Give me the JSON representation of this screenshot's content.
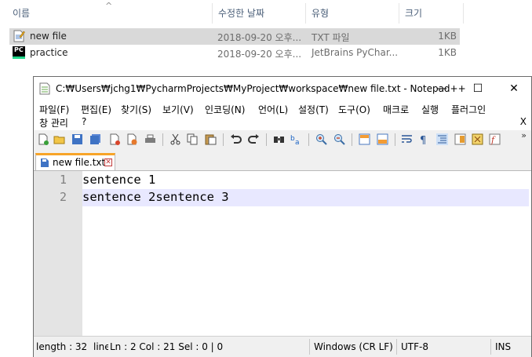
{
  "explorer": {
    "columns": {
      "name": "이름",
      "date": "수정한 날짜",
      "type": "유형",
      "size": "크기"
    },
    "files": [
      {
        "name": "new file",
        "date": "2018-09-20 오후...",
        "type": "TXT 파일",
        "size": "1KB",
        "icon": "text-file-icon",
        "selected": true
      },
      {
        "name": "practice",
        "date": "2018-09-20 오후...",
        "type": "JetBrains PyChar...",
        "size": "1KB",
        "icon": "pycharm-icon",
        "selected": false
      }
    ]
  },
  "window": {
    "title": "C:₩Users₩jchg1₩PycharmProjects₩MyProject₩workspace₩new file.txt - Notepad++",
    "controls": {
      "minimize": "—",
      "maximize": "☐",
      "close": "✕"
    }
  },
  "menu": {
    "items": [
      "파일(F)",
      "편집(E)",
      "찾기(S)",
      "보기(V)",
      "인코딩(N)",
      "언어(L)",
      "설정(T)",
      "도구(O)",
      "매크로",
      "실행",
      "플러그인"
    ],
    "items_row2": [
      "창 관리",
      "?"
    ],
    "close_label": "X"
  },
  "toolbar": {
    "icons": [
      "new-file-icon",
      "open-file-icon",
      "save-icon",
      "save-all-icon",
      "close-icon",
      "close-all-icon",
      "print-icon",
      "cut-icon",
      "copy-icon",
      "paste-icon",
      "undo-icon",
      "redo-icon",
      "find-icon",
      "replace-icon",
      "zoom-in-icon",
      "zoom-out-icon",
      "sync-vertical-icon",
      "sync-horizontal-icon",
      "word-wrap-icon",
      "show-all-chars-icon",
      "indent-guide-icon",
      "doc-map-icon",
      "function-list-icon",
      "folder-as-workspace-icon"
    ],
    "more_label": "»"
  },
  "tabs": [
    {
      "label": "new file.txt",
      "close_label": "✕"
    }
  ],
  "editor": {
    "lines": [
      {
        "number": "1",
        "text": "sentence 1"
      },
      {
        "number": "2",
        "text": "sentence 2sentence 3"
      }
    ],
    "current_line": 2
  },
  "status": {
    "length": "length : 32",
    "lines": "lines",
    "position": "Ln : 2    Col : 21    Sel : 0 | 0",
    "eol": "Windows (CR LF)",
    "encoding": "UTF-8",
    "mode": "INS"
  }
}
